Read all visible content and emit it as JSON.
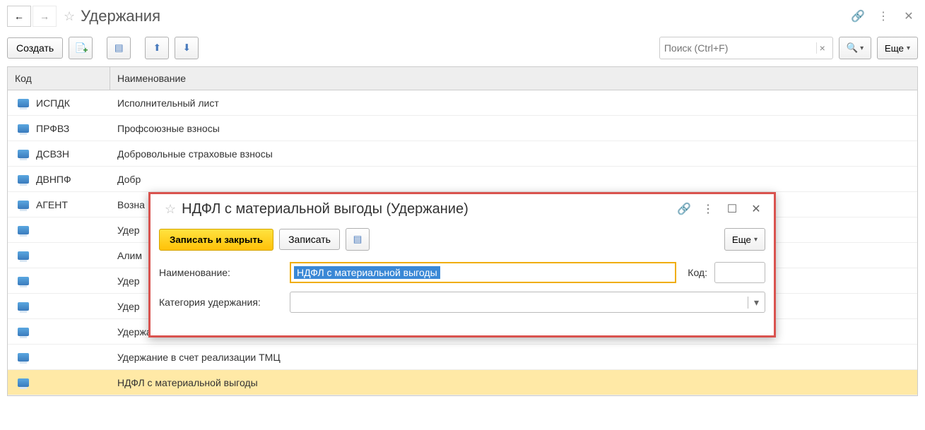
{
  "header": {
    "title": "Удержания"
  },
  "toolbar": {
    "create_label": "Создать",
    "more_label": "Еще"
  },
  "search": {
    "placeholder": "Поиск (Ctrl+F)"
  },
  "table": {
    "col_code": "Код",
    "col_name": "Наименование",
    "rows": [
      {
        "code": "ИСПДК",
        "name": "Исполнительный лист"
      },
      {
        "code": "ПРФВЗ",
        "name": "Профсоюзные взносы"
      },
      {
        "code": "ДСВЗН",
        "name": "Добровольные страховые взносы"
      },
      {
        "code": "ДВНПФ",
        "name": "Добр"
      },
      {
        "code": "АГЕНТ",
        "name": "Возна"
      },
      {
        "code": "",
        "name": "Удер"
      },
      {
        "code": "",
        "name": "Алим"
      },
      {
        "code": "",
        "name": "Удер"
      },
      {
        "code": "",
        "name": "Удер"
      },
      {
        "code": "",
        "name": "Удержание подотчетной суммы"
      },
      {
        "code": "",
        "name": "Удержание в счет реализации ТМЦ"
      },
      {
        "code": "",
        "name": "НДФЛ с материальной выгоды"
      }
    ]
  },
  "modal": {
    "title": "НДФЛ с материальной выгоды (Удержание)",
    "save_close_label": "Записать и закрыть",
    "save_label": "Записать",
    "more_label": "Еще",
    "name_label": "Наименование:",
    "name_value": "НДФЛ с материальной выгоды",
    "code_label": "Код:",
    "code_value": "",
    "category_label": "Категория удержания:",
    "category_value": ""
  }
}
